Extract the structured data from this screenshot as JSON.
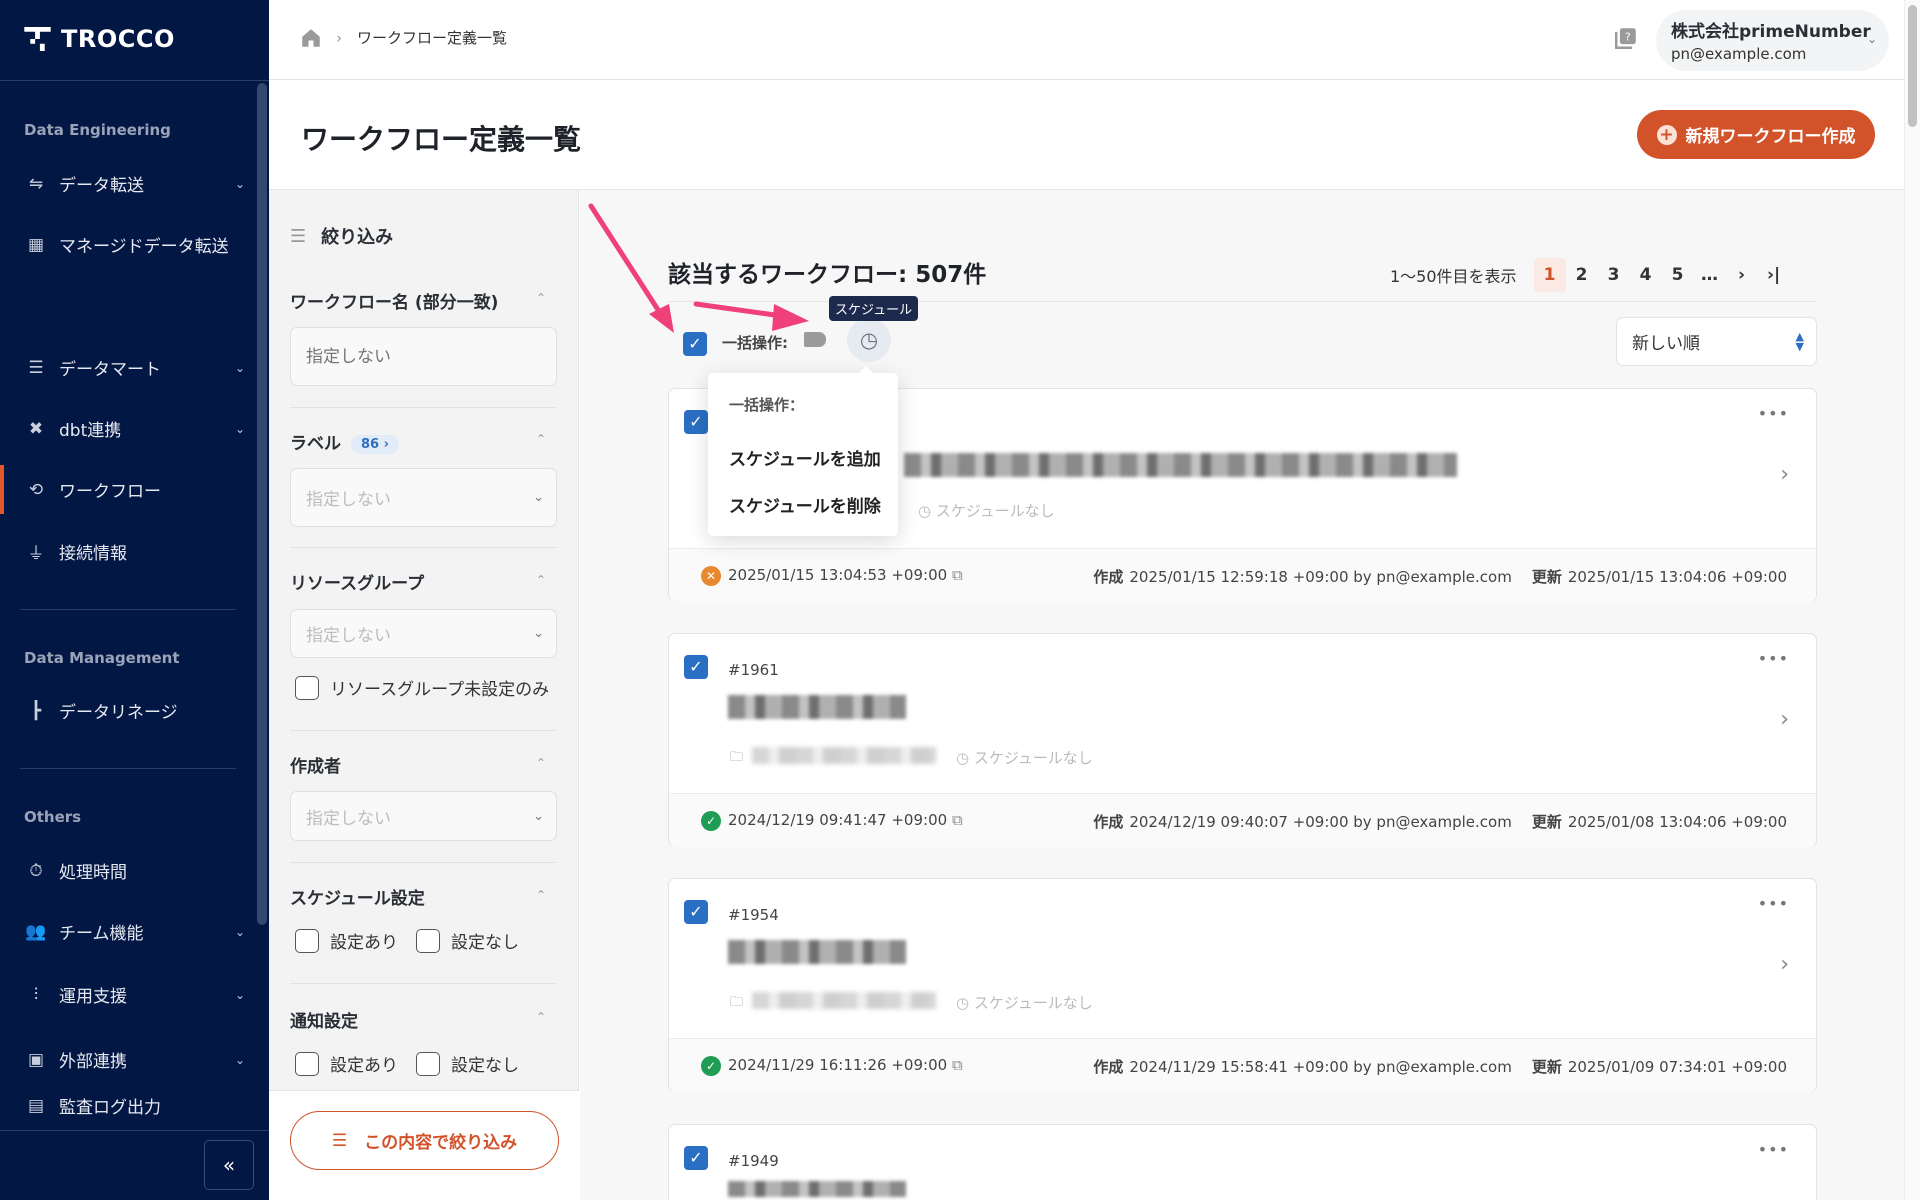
{
  "sidebar": {
    "brand": "TROCCO",
    "sections": [
      {
        "title": "Data Engineering"
      },
      {
        "title": "Data Management"
      },
      {
        "title": "Others"
      }
    ],
    "items": [
      {
        "label": "データ転送",
        "icon": "transfer-icon",
        "expandable": true
      },
      {
        "label": "マネージドデータ転送",
        "icon": "grid-icon",
        "expandable": false
      },
      {
        "label": "データマート",
        "icon": "database-icon",
        "expandable": true
      },
      {
        "label": "dbt連携",
        "icon": "dbt-icon",
        "expandable": true
      },
      {
        "label": "ワークフロー",
        "icon": "workflow-icon",
        "expandable": false,
        "active": true
      },
      {
        "label": "接続情報",
        "icon": "plug-icon",
        "expandable": false
      },
      {
        "label": "データリネージ",
        "icon": "lineage-icon",
        "expandable": false
      },
      {
        "label": "処理時間",
        "icon": "stopwatch-icon",
        "expandable": false
      },
      {
        "label": "チーム機能",
        "icon": "team-icon",
        "expandable": true
      },
      {
        "label": "運用支援",
        "icon": "sliders-icon",
        "expandable": true
      },
      {
        "label": "外部連携",
        "icon": "external-icon",
        "expandable": true
      },
      {
        "label": "監査ログ出力",
        "icon": "audit-log-icon",
        "expandable": false
      }
    ],
    "collapse_label": "«"
  },
  "header": {
    "breadcrumb": "ワークフロー定義一覧",
    "account_name": "株式会社primeNumber",
    "account_email": "pn@example.com"
  },
  "page": {
    "title": "ワークフロー定義一覧",
    "new_button": "新規ワークフロー作成"
  },
  "filter": {
    "title": "絞り込み",
    "name_label": "ワークフロー名 (部分一致)",
    "name_placeholder": "指定しない",
    "label_label": "ラベル",
    "label_count": "86 ›",
    "label_placeholder": "指定しない",
    "resource_label": "リソースグループ",
    "resource_placeholder": "指定しない",
    "resource_unset": "リソースグループ未設定のみ",
    "creator_label": "作成者",
    "creator_placeholder": "指定しない",
    "schedule_label": "スケジュール設定",
    "notify_label": "通知設定",
    "opt_yes": "設定あり",
    "opt_no": "設定なし",
    "apply_button": "この内容で絞り込み"
  },
  "list": {
    "count_title": "該当するワークフロー: 507件",
    "range": "1～50件目を表示",
    "pages": [
      "1",
      "2",
      "3",
      "4",
      "5",
      "…",
      "›",
      "›|"
    ],
    "current_page": "1",
    "bulk_label": "一括操作:",
    "tooltip": "スケジュール",
    "sort": "新しい順",
    "created_label": "作成",
    "updated_label": "更新",
    "no_schedule": "スケジュールなし",
    "more": "•••",
    "cards": [
      {
        "id": "",
        "status": "error",
        "last_run": "2025/01/15 13:04:53 +09:00",
        "created": "2025/01/15 12:59:18 +09:00 by pn@example.com",
        "updated": "2025/01/15 13:04:06 +09:00"
      },
      {
        "id": "#1961",
        "status": "success",
        "last_run": "2024/12/19 09:41:47 +09:00",
        "created": "2024/12/19 09:40:07 +09:00 by pn@example.com",
        "updated": "2025/01/08 13:04:06 +09:00"
      },
      {
        "id": "#1954",
        "status": "success",
        "last_run": "2024/11/29 16:11:26 +09:00",
        "created": "2024/11/29 15:58:41 +09:00 by pn@example.com",
        "updated": "2025/01/09 07:34:01 +09:00"
      },
      {
        "id": "#1949",
        "status": "success",
        "last_run": "",
        "created": "",
        "updated": ""
      }
    ]
  },
  "bulk_menu": {
    "header": "一括操作：",
    "items": [
      "スケジュールを追加",
      "スケジュールを削除"
    ]
  },
  "colors": {
    "sidebar": "#031744",
    "accent": "#d2522a",
    "checkbox": "#2b6fc4",
    "success": "#1f9d55",
    "error": "#e8892f",
    "annotation_arrow": "#f0407a"
  }
}
